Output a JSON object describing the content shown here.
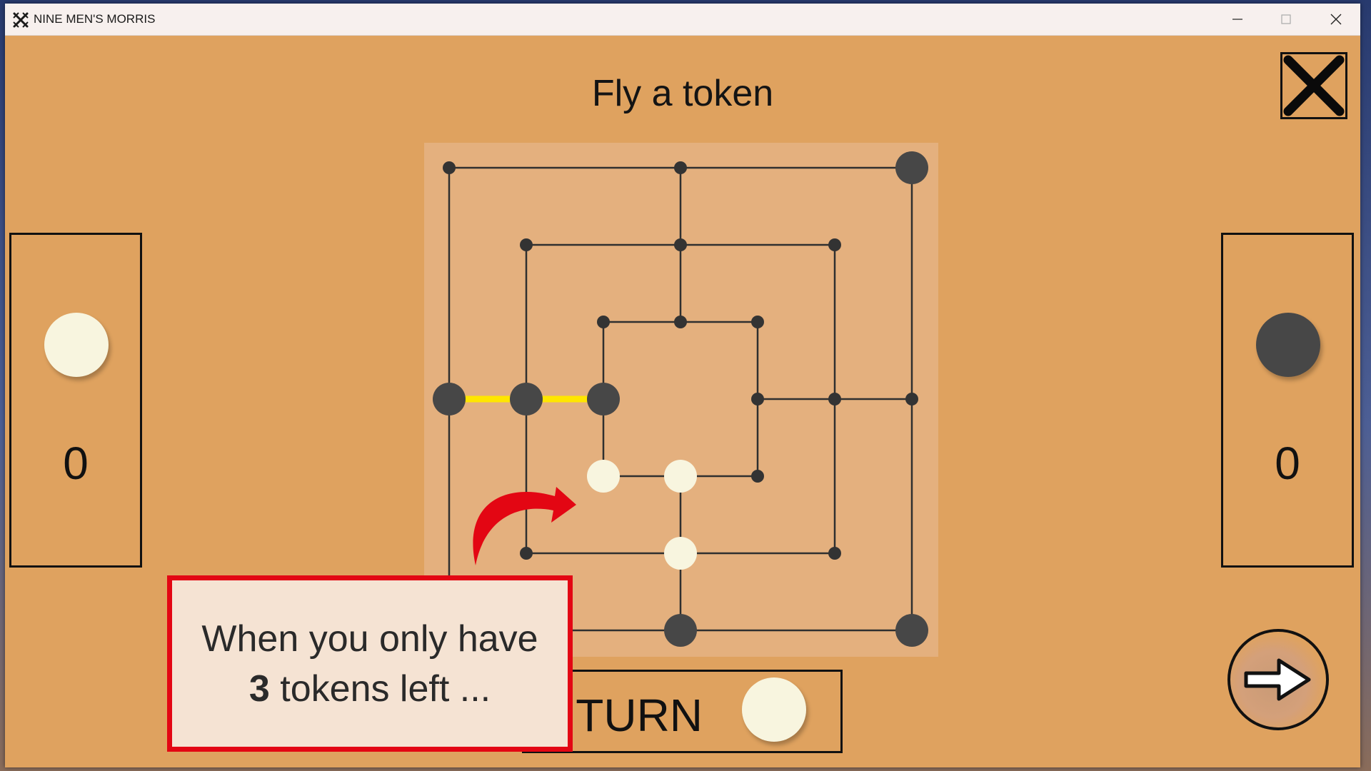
{
  "window": {
    "title": "NINE MEN'S MORRIS",
    "icons": [
      "crossed-swords-icon",
      "minimize-icon",
      "maximize-icon",
      "close-icon"
    ]
  },
  "game": {
    "heading": "Fly a token",
    "player_left": {
      "token_color": "#f8f5df",
      "score": "0"
    },
    "player_right": {
      "token_color": "#474747",
      "score": "0"
    },
    "turn": {
      "label": "TURN",
      "token_color": "#f8f5df"
    },
    "board": {
      "light_tokens_at": [
        "inner-bottom-left",
        "inner-bottom-mid",
        "middle-bottom-mid"
      ],
      "dark_tokens_at": [
        "outer-top-right",
        "outer-mid-left",
        "middle-mid-left",
        "inner-mid-left",
        "outer-bottom-mid",
        "outer-bottom-right"
      ],
      "highlighted_mill": [
        "outer-mid-left",
        "middle-mid-left",
        "inner-mid-left"
      ],
      "mill_color": "#ffe600"
    }
  },
  "tutorial": {
    "line1": "When you only have",
    "line2_bold": "3",
    "line2_rest": " tokens left ...",
    "arrow_color": "#e30613"
  },
  "colors": {
    "background": "#dfa25f",
    "board": "#e4b07e",
    "light_token": "#f8f5df",
    "dark_token": "#474747"
  }
}
